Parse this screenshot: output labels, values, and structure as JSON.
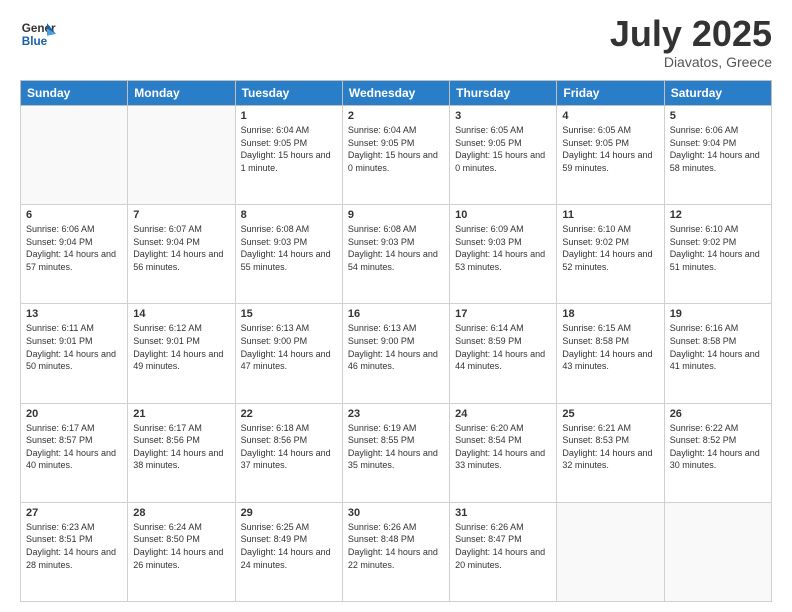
{
  "header": {
    "logo_line1": "General",
    "logo_line2": "Blue",
    "month_year": "July 2025",
    "location": "Diavatos, Greece"
  },
  "weekdays": [
    "Sunday",
    "Monday",
    "Tuesday",
    "Wednesday",
    "Thursday",
    "Friday",
    "Saturday"
  ],
  "weeks": [
    [
      {
        "day": "",
        "sunrise": "",
        "sunset": "",
        "daylight": "",
        "empty": true
      },
      {
        "day": "",
        "sunrise": "",
        "sunset": "",
        "daylight": "",
        "empty": true
      },
      {
        "day": "1",
        "sunrise": "Sunrise: 6:04 AM",
        "sunset": "Sunset: 9:05 PM",
        "daylight": "Daylight: 15 hours and 1 minute."
      },
      {
        "day": "2",
        "sunrise": "Sunrise: 6:04 AM",
        "sunset": "Sunset: 9:05 PM",
        "daylight": "Daylight: 15 hours and 0 minutes."
      },
      {
        "day": "3",
        "sunrise": "Sunrise: 6:05 AM",
        "sunset": "Sunset: 9:05 PM",
        "daylight": "Daylight: 15 hours and 0 minutes."
      },
      {
        "day": "4",
        "sunrise": "Sunrise: 6:05 AM",
        "sunset": "Sunset: 9:05 PM",
        "daylight": "Daylight: 14 hours and 59 minutes."
      },
      {
        "day": "5",
        "sunrise": "Sunrise: 6:06 AM",
        "sunset": "Sunset: 9:04 PM",
        "daylight": "Daylight: 14 hours and 58 minutes."
      }
    ],
    [
      {
        "day": "6",
        "sunrise": "Sunrise: 6:06 AM",
        "sunset": "Sunset: 9:04 PM",
        "daylight": "Daylight: 14 hours and 57 minutes."
      },
      {
        "day": "7",
        "sunrise": "Sunrise: 6:07 AM",
        "sunset": "Sunset: 9:04 PM",
        "daylight": "Daylight: 14 hours and 56 minutes."
      },
      {
        "day": "8",
        "sunrise": "Sunrise: 6:08 AM",
        "sunset": "Sunset: 9:03 PM",
        "daylight": "Daylight: 14 hours and 55 minutes."
      },
      {
        "day": "9",
        "sunrise": "Sunrise: 6:08 AM",
        "sunset": "Sunset: 9:03 PM",
        "daylight": "Daylight: 14 hours and 54 minutes."
      },
      {
        "day": "10",
        "sunrise": "Sunrise: 6:09 AM",
        "sunset": "Sunset: 9:03 PM",
        "daylight": "Daylight: 14 hours and 53 minutes."
      },
      {
        "day": "11",
        "sunrise": "Sunrise: 6:10 AM",
        "sunset": "Sunset: 9:02 PM",
        "daylight": "Daylight: 14 hours and 52 minutes."
      },
      {
        "day": "12",
        "sunrise": "Sunrise: 6:10 AM",
        "sunset": "Sunset: 9:02 PM",
        "daylight": "Daylight: 14 hours and 51 minutes."
      }
    ],
    [
      {
        "day": "13",
        "sunrise": "Sunrise: 6:11 AM",
        "sunset": "Sunset: 9:01 PM",
        "daylight": "Daylight: 14 hours and 50 minutes."
      },
      {
        "day": "14",
        "sunrise": "Sunrise: 6:12 AM",
        "sunset": "Sunset: 9:01 PM",
        "daylight": "Daylight: 14 hours and 49 minutes."
      },
      {
        "day": "15",
        "sunrise": "Sunrise: 6:13 AM",
        "sunset": "Sunset: 9:00 PM",
        "daylight": "Daylight: 14 hours and 47 minutes."
      },
      {
        "day": "16",
        "sunrise": "Sunrise: 6:13 AM",
        "sunset": "Sunset: 9:00 PM",
        "daylight": "Daylight: 14 hours and 46 minutes."
      },
      {
        "day": "17",
        "sunrise": "Sunrise: 6:14 AM",
        "sunset": "Sunset: 8:59 PM",
        "daylight": "Daylight: 14 hours and 44 minutes."
      },
      {
        "day": "18",
        "sunrise": "Sunrise: 6:15 AM",
        "sunset": "Sunset: 8:58 PM",
        "daylight": "Daylight: 14 hours and 43 minutes."
      },
      {
        "day": "19",
        "sunrise": "Sunrise: 6:16 AM",
        "sunset": "Sunset: 8:58 PM",
        "daylight": "Daylight: 14 hours and 41 minutes."
      }
    ],
    [
      {
        "day": "20",
        "sunrise": "Sunrise: 6:17 AM",
        "sunset": "Sunset: 8:57 PM",
        "daylight": "Daylight: 14 hours and 40 minutes."
      },
      {
        "day": "21",
        "sunrise": "Sunrise: 6:17 AM",
        "sunset": "Sunset: 8:56 PM",
        "daylight": "Daylight: 14 hours and 38 minutes."
      },
      {
        "day": "22",
        "sunrise": "Sunrise: 6:18 AM",
        "sunset": "Sunset: 8:56 PM",
        "daylight": "Daylight: 14 hours and 37 minutes."
      },
      {
        "day": "23",
        "sunrise": "Sunrise: 6:19 AM",
        "sunset": "Sunset: 8:55 PM",
        "daylight": "Daylight: 14 hours and 35 minutes."
      },
      {
        "day": "24",
        "sunrise": "Sunrise: 6:20 AM",
        "sunset": "Sunset: 8:54 PM",
        "daylight": "Daylight: 14 hours and 33 minutes."
      },
      {
        "day": "25",
        "sunrise": "Sunrise: 6:21 AM",
        "sunset": "Sunset: 8:53 PM",
        "daylight": "Daylight: 14 hours and 32 minutes."
      },
      {
        "day": "26",
        "sunrise": "Sunrise: 6:22 AM",
        "sunset": "Sunset: 8:52 PM",
        "daylight": "Daylight: 14 hours and 30 minutes."
      }
    ],
    [
      {
        "day": "27",
        "sunrise": "Sunrise: 6:23 AM",
        "sunset": "Sunset: 8:51 PM",
        "daylight": "Daylight: 14 hours and 28 minutes."
      },
      {
        "day": "28",
        "sunrise": "Sunrise: 6:24 AM",
        "sunset": "Sunset: 8:50 PM",
        "daylight": "Daylight: 14 hours and 26 minutes."
      },
      {
        "day": "29",
        "sunrise": "Sunrise: 6:25 AM",
        "sunset": "Sunset: 8:49 PM",
        "daylight": "Daylight: 14 hours and 24 minutes."
      },
      {
        "day": "30",
        "sunrise": "Sunrise: 6:26 AM",
        "sunset": "Sunset: 8:48 PM",
        "daylight": "Daylight: 14 hours and 22 minutes."
      },
      {
        "day": "31",
        "sunrise": "Sunrise: 6:26 AM",
        "sunset": "Sunset: 8:47 PM",
        "daylight": "Daylight: 14 hours and 20 minutes."
      },
      {
        "day": "",
        "sunrise": "",
        "sunset": "",
        "daylight": "",
        "empty": true
      },
      {
        "day": "",
        "sunrise": "",
        "sunset": "",
        "daylight": "",
        "empty": true
      }
    ]
  ]
}
